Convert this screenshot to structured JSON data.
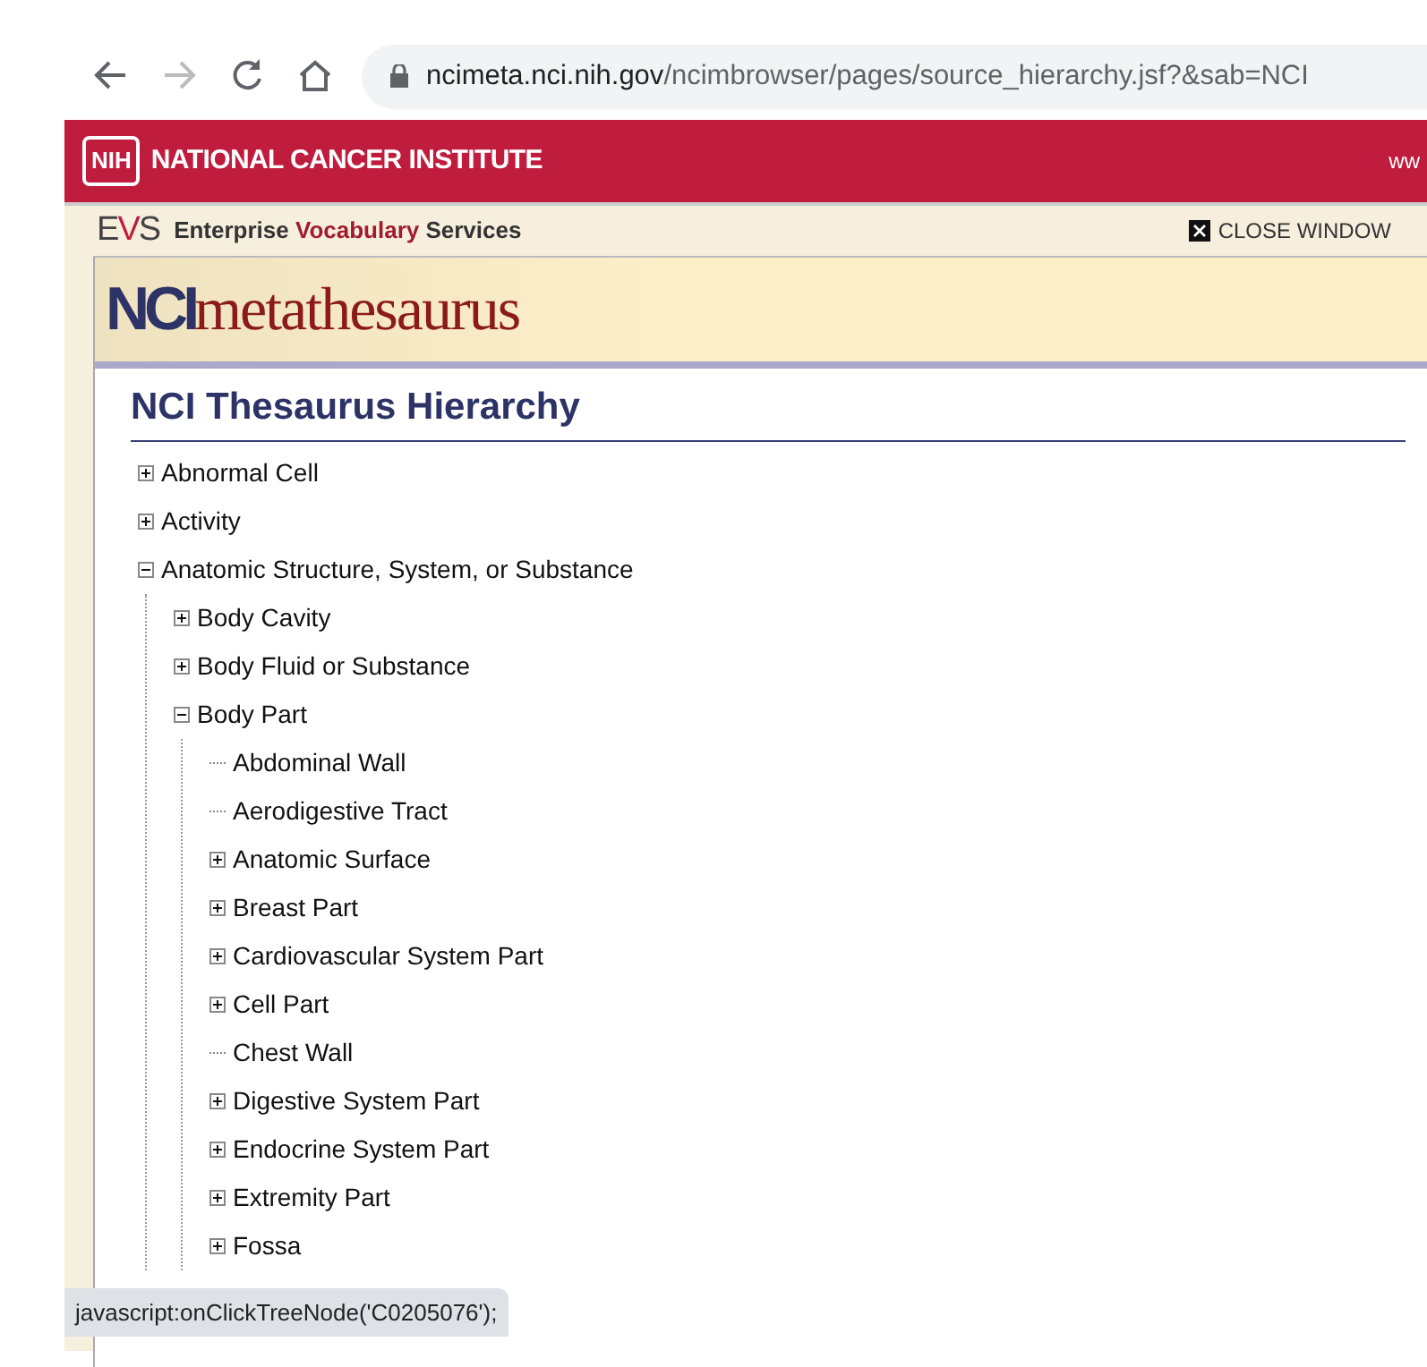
{
  "browser": {
    "url_host": "ncimeta.nci.nih.gov",
    "url_path": "/ncimbrowser/pages/source_hierarchy.jsf?&sab=NCI"
  },
  "banner": {
    "badge": "NIH",
    "title": "NATIONAL CANCER INSTITUTE",
    "right_text": "ww"
  },
  "evs": {
    "logo": "EVS",
    "words": [
      "Enterprise",
      "Vocabulary",
      "Services"
    ],
    "close": "CLOSE WINDOW"
  },
  "product": {
    "logo_bold": "NCI",
    "logo_rest": "metathesaurus"
  },
  "heading": "NCI Thesaurus Hierarchy",
  "tree": [
    {
      "label": "Abnormal Cell",
      "kind": "node",
      "expanded": false
    },
    {
      "label": "Activity",
      "kind": "node",
      "expanded": false
    },
    {
      "label": "Anatomic Structure, System, or Substance",
      "kind": "node",
      "expanded": true,
      "children": [
        {
          "label": "Body Cavity",
          "kind": "node",
          "expanded": false
        },
        {
          "label": "Body Fluid or Substance",
          "kind": "node",
          "expanded": false
        },
        {
          "label": "Body Part",
          "kind": "node",
          "expanded": true,
          "children": [
            {
              "label": "Abdominal Wall",
              "kind": "leaf"
            },
            {
              "label": "Aerodigestive Tract",
              "kind": "leaf"
            },
            {
              "label": "Anatomic Surface",
              "kind": "node",
              "expanded": false
            },
            {
              "label": "Breast Part",
              "kind": "node",
              "expanded": false
            },
            {
              "label": "Cardiovascular System Part",
              "kind": "node",
              "expanded": false
            },
            {
              "label": "Cell Part",
              "kind": "node",
              "expanded": false
            },
            {
              "label": "Chest Wall",
              "kind": "leaf"
            },
            {
              "label": "Digestive System Part",
              "kind": "node",
              "expanded": false
            },
            {
              "label": "Endocrine System Part",
              "kind": "node",
              "expanded": false
            },
            {
              "label": "Extremity Part",
              "kind": "node",
              "expanded": false
            },
            {
              "label": "Fossa",
              "kind": "node",
              "expanded": false
            }
          ]
        }
      ]
    }
  ],
  "status_text": "javascript:onClickTreeNode('C0205076');"
}
